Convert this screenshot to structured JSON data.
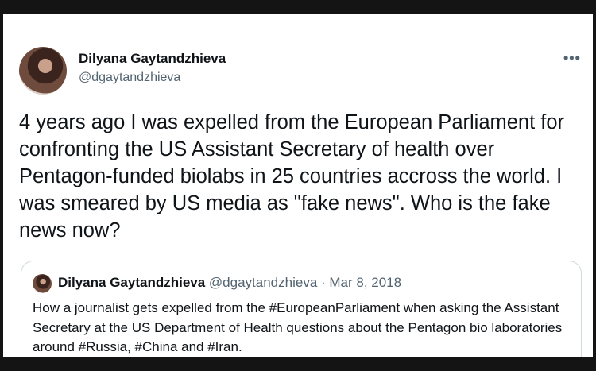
{
  "tweet": {
    "author": {
      "name": "Dilyana Gaytandzhieva",
      "handle": "@dgaytandzhieva"
    },
    "more_label": "•••",
    "text": "4 years ago I was expelled from the European Parliament for confronting the US Assistant Secretary of health over Pentagon-funded biolabs in 25 countries accross the world. I was smeared by US media as \"fake news\". Who is the fake news now?"
  },
  "quoted_tweet": {
    "author_name": "Dilyana Gaytandzhieva",
    "meta": "@dgaytandzhieva · Mar 8, 2018",
    "text": "How a journalist gets expelled from the #EuropeanParliament when asking the Assistant Secretary at the US Department of Health questions about the Pentagon bio laboratories around #Russia, #China and #Iran."
  }
}
